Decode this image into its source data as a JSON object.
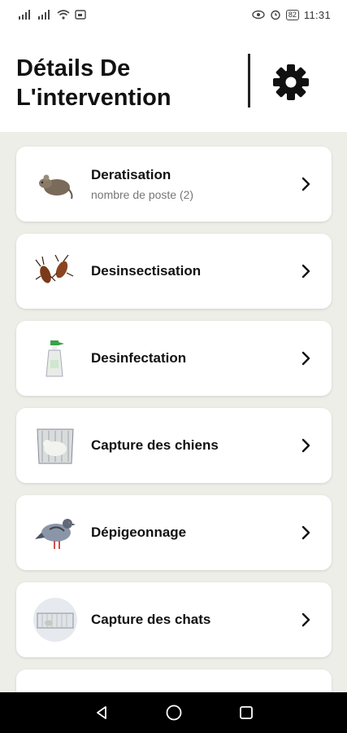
{
  "status_bar": {
    "left_text": "⁴⁶ ⁴⁶",
    "time": "11:31",
    "battery": "82"
  },
  "header": {
    "title": "Détails De\nL'intervention"
  },
  "services": [
    {
      "name": "Deratisation",
      "subtitle": "nombre de poste (2)",
      "icon": "rat-icon"
    },
    {
      "name": "Desinsectisation",
      "subtitle": "",
      "icon": "cockroach-icon"
    },
    {
      "name": "Desinfectation",
      "subtitle": "",
      "icon": "spray-bottle-icon"
    },
    {
      "name": "Capture des chiens",
      "subtitle": "",
      "icon": "dog-cage-icon"
    },
    {
      "name": "Dépigeonnage",
      "subtitle": "",
      "icon": "pigeon-icon"
    },
    {
      "name": "Capture des chats",
      "subtitle": "",
      "icon": "cat-trap-icon"
    }
  ],
  "colors": {
    "background": "#eeeee8",
    "card": "#ffffff",
    "text": "#111111",
    "subtext": "#777777",
    "nav_bar": "#000000"
  }
}
